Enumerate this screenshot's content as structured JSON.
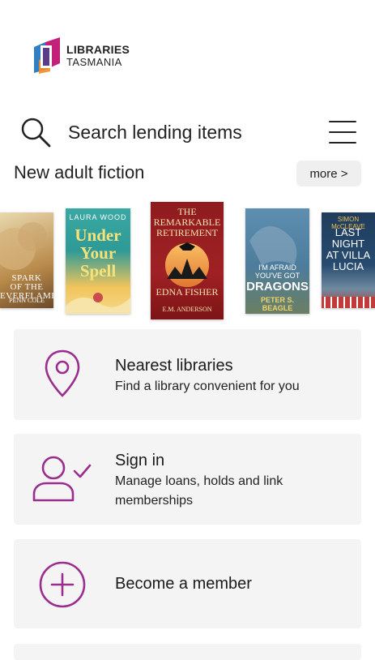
{
  "app": {
    "logo_line1": "LIBRARIES",
    "logo_line2": "TASMANIA"
  },
  "search": {
    "placeholder": "Search lending items"
  },
  "icons": {
    "search": "search-icon",
    "menu": "hamburger-menu-icon",
    "location": "location-pin-icon",
    "user": "user-check-icon",
    "add": "plus-circle-icon"
  },
  "section": {
    "title": "New adult fiction",
    "more_label": "more >"
  },
  "books": [
    {
      "title": "SPARK OF THE EVERFLAME",
      "author": "PENN COLE"
    },
    {
      "title": "Under Your Spell",
      "author": "LAURA WOOD"
    },
    {
      "title": "The Remarkable Retirement of Edna Fisher",
      "author": "E.M. ANDERSON"
    },
    {
      "title": "I'M AFRAID YOU'VE GOT DRAGONS",
      "author": "PETER S. BEAGLE"
    },
    {
      "title": "LAST NIGHT AT VILLA LUCIA",
      "author": "SIMON McCLEAVE"
    }
  ],
  "cards": [
    {
      "title": "Nearest libraries",
      "subtitle": "Find a library convenient for you"
    },
    {
      "title": "Sign in",
      "subtitle_line1": "Manage loans, holds and link",
      "subtitle_line2": "memberships"
    },
    {
      "title": "Become a member"
    }
  ],
  "colors": {
    "accent": "#9b2d8f",
    "card_bg": "#f4f4f4"
  }
}
